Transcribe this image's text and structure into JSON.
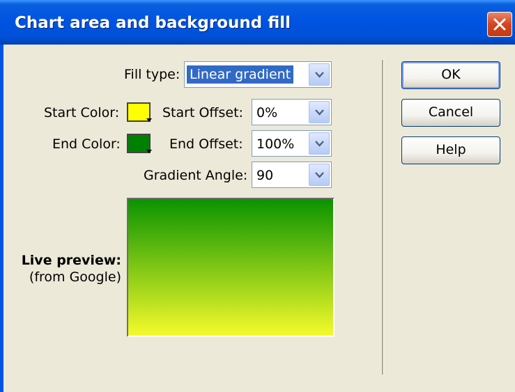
{
  "window": {
    "title": "Chart area and background fill"
  },
  "fill_type": {
    "label": "Fill type:",
    "value": "Linear gradient"
  },
  "start_color": {
    "label": "Start Color:",
    "color": "#ffff00"
  },
  "end_color": {
    "label": "End Color:",
    "color": "#008000"
  },
  "start_offset": {
    "label": "Start Offset:",
    "value": "0%"
  },
  "end_offset": {
    "label": "End Offset:",
    "value": "100%"
  },
  "gradient_angle": {
    "label": "Gradient Angle:",
    "value": "90"
  },
  "preview": {
    "label": "Live preview:",
    "sublabel": "(from Google)",
    "top_color": "#0a9300",
    "bottom_color": "#f5fa2b"
  },
  "buttons": {
    "ok": "OK",
    "cancel": "Cancel",
    "help": "Help"
  },
  "colors": {
    "titlebar": "#0054e3",
    "dialog_bg": "#ece9d8",
    "selection": "#316ac5"
  }
}
